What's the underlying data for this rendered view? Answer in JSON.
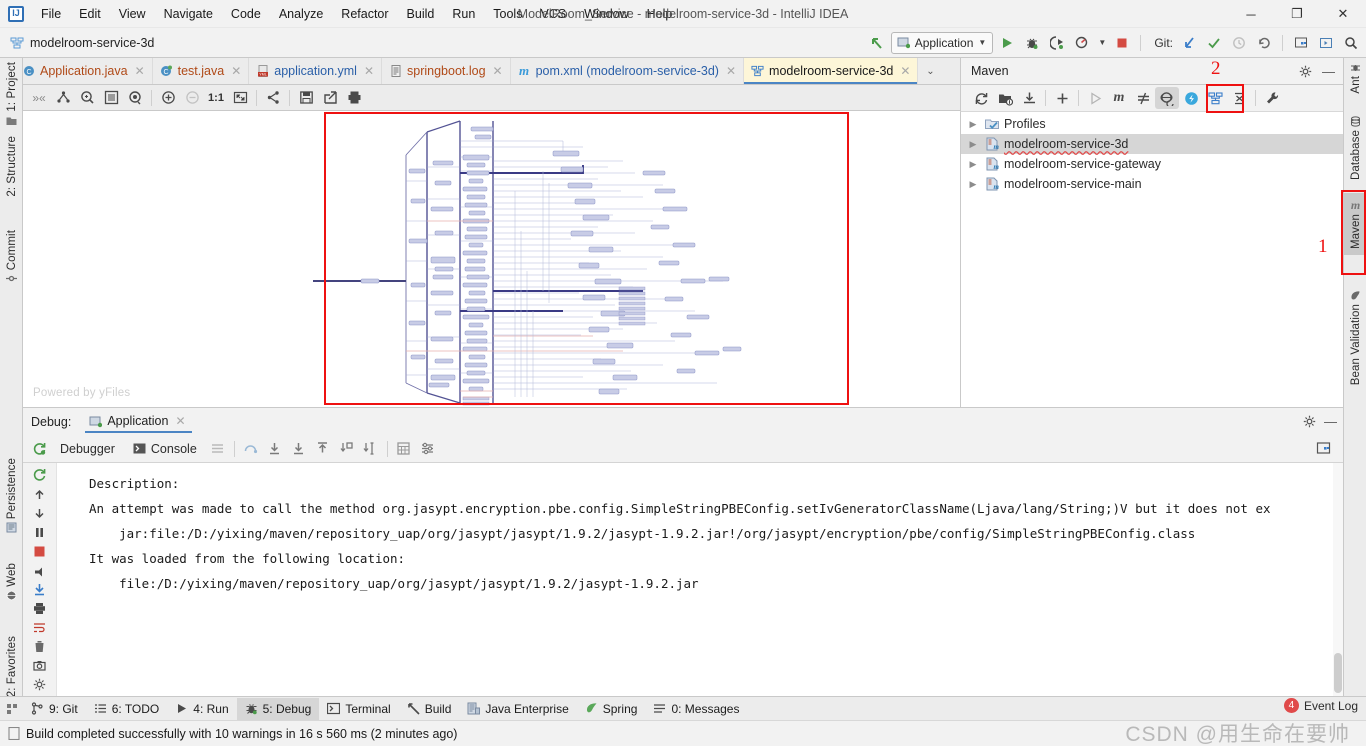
{
  "window": {
    "title": "ModelRoom_Service - modelroom-service-3d - IntelliJ IDEA",
    "minimize": "─",
    "maximize": "❐",
    "close": "✕",
    "logo_letters": "IJ"
  },
  "menu": {
    "items": [
      "File",
      "Edit",
      "View",
      "Navigate",
      "Code",
      "Analyze",
      "Refactor",
      "Build",
      "Run",
      "Tools",
      "VCS",
      "Window",
      "Help"
    ]
  },
  "navbar": {
    "breadcrumb": "modelroom-service-3d",
    "run_config": "Application",
    "git_label": "Git:",
    "icons": [
      "back-arrow-icon",
      "run-icon",
      "debug-icon",
      "run-coverage-icon",
      "profile-icon",
      "stop-icon",
      "update-project-icon",
      "commit-icon",
      "history-icon",
      "rollback-icon",
      "settings-icon",
      "select-in-icon",
      "search-everywhere-icon"
    ]
  },
  "left_stripe": {
    "items": [
      {
        "label": "1: Project",
        "icon": "project-icon"
      },
      {
        "label": "2: Structure",
        "icon": "structure-icon"
      },
      {
        "label": "Commit",
        "icon": "commit-icon"
      },
      {
        "label": "Persistence",
        "icon": "persistence-icon"
      },
      {
        "label": "Web",
        "icon": "web-icon"
      },
      {
        "label": "2: Favorites",
        "icon": "favorites-icon"
      }
    ]
  },
  "right_stripe": {
    "items": [
      {
        "label": "Ant",
        "icon": "ant-icon",
        "active": false
      },
      {
        "label": "Database",
        "icon": "database-icon",
        "active": false
      },
      {
        "label": "Maven",
        "icon": "maven-icon",
        "active": true
      },
      {
        "label": "Bean Validation",
        "icon": "bean-validation-icon",
        "active": false
      }
    ]
  },
  "editor_tabs": [
    {
      "label": "Application.java",
      "icon": "java-class-icon",
      "active": false
    },
    {
      "label": "test.java",
      "icon": "java-class-icon",
      "active": false
    },
    {
      "label": "application.yml",
      "icon": "yml-file-icon",
      "active": false
    },
    {
      "label": "springboot.log",
      "icon": "log-file-icon",
      "active": false
    },
    {
      "label": "pom.xml (modelroom-service-3d)",
      "icon": "maven-pom-icon",
      "active": false
    },
    {
      "label": "modelroom-service-3d",
      "icon": "diagram-icon",
      "active": true
    }
  ],
  "editor_toolbar": {
    "icons": [
      "expand-collapse-icon",
      "layout-icon",
      "fit-selection-icon",
      "fit-content-icon",
      "show-view-icon",
      "zoom-in-icon",
      "zoom-out-icon",
      "actual-size-icon",
      "fit-window-icon",
      "share-icon",
      "save-icon",
      "export-icon",
      "print-icon"
    ],
    "actual_size_label": "1:1"
  },
  "canvas": {
    "watermark": "Powered by yFiles"
  },
  "maven": {
    "title": "Maven",
    "toolbar_icons": [
      "refresh-icon",
      "add-maven-project-icon",
      "download-sources-icon",
      "add-icon",
      "run-icon",
      "execute-maven-goal-icon",
      "toggle-skip-tests-icon",
      "toggle-offline-icon",
      "show-dependencies-icon",
      "show-diagram-icon",
      "collapse-all-icon",
      "maven-settings-icon"
    ],
    "tree": [
      {
        "label": "Profiles",
        "icon": "profiles-icon",
        "selected": false,
        "error": false
      },
      {
        "label": "modelroom-service-3d",
        "icon": "maven-module-icon",
        "selected": true,
        "error": true
      },
      {
        "label": "modelroom-service-gateway",
        "icon": "maven-module-icon",
        "selected": false,
        "error": false
      },
      {
        "label": "modelroom-service-main",
        "icon": "maven-module-icon",
        "selected": false,
        "error": false
      }
    ]
  },
  "debug": {
    "panel_label": "Debug:",
    "session_tab": "Application",
    "tabs": [
      "Debugger",
      "Console"
    ],
    "active_tab": "Console",
    "console_lines": [
      "Description:",
      "",
      "An attempt was made to call the method org.jasypt.encryption.pbe.config.SimpleStringPBEConfig.setIvGeneratorClassName(Ljava/lang/String;)V but it does not ex",
      "",
      "    jar:file:/D:/yixing/maven/repository_uap/org/jasypt/jasypt/1.9.2/jasypt-1.9.2.jar!/org/jasypt/encryption/pbe/config/SimpleStringPBEConfig.class",
      "",
      "It was loaded from the following location:",
      "",
      "    file:/D:/yixing/maven/repository_uap/org/jasypt/jasypt/1.9.2/jasypt-1.9.2.jar"
    ]
  },
  "bottom_bar": {
    "items": [
      {
        "label": "9: Git",
        "icon": "git-branch-icon",
        "active": false
      },
      {
        "label": "6: TODO",
        "icon": "todo-icon",
        "active": false
      },
      {
        "label": "4: Run",
        "icon": "run-icon",
        "active": false
      },
      {
        "label": "5: Debug",
        "icon": "debug-icon",
        "active": true
      },
      {
        "label": "Terminal",
        "icon": "terminal-icon",
        "active": false
      },
      {
        "label": "Build",
        "icon": "build-hammer-icon",
        "active": false
      },
      {
        "label": "Java Enterprise",
        "icon": "java-enterprise-icon",
        "active": false
      },
      {
        "label": "Spring",
        "icon": "spring-leaf-icon",
        "active": false
      },
      {
        "label": "0: Messages",
        "icon": "messages-icon",
        "active": false
      }
    ],
    "event_log": "Event Log",
    "event_log_count": "4"
  },
  "status": {
    "message": "Build completed successfully with 10 warnings in 16 s 560 ms (2 minutes ago)"
  },
  "annotations": [
    {
      "label": "1",
      "color": "#ee1111"
    },
    {
      "label": "2",
      "color": "#ee1111"
    }
  ],
  "watermark": "CSDN @用生命在要帅",
  "colors": {
    "accent": "#4b85c4",
    "annotation_red": "#ee1111",
    "active_tab_bg": "#fdf6d8",
    "panel_bg": "#f2f2f2",
    "selection_gray": "#d6d6d6"
  }
}
